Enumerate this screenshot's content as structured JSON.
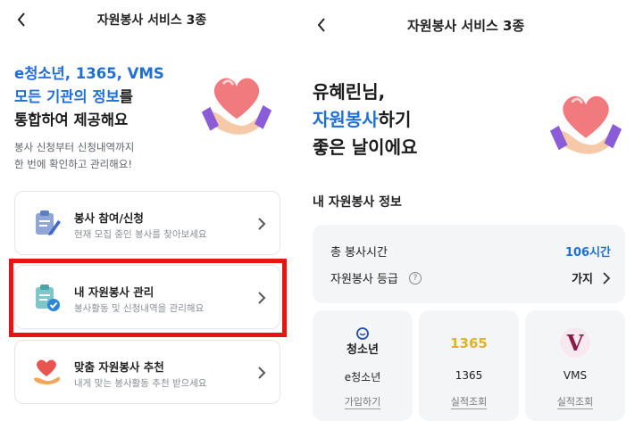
{
  "left": {
    "title": "자원봉사 서비스 3종",
    "hero": {
      "line1": "e청소년, 1365, VMS",
      "line2_blue": "모든 기관의 정보",
      "line2_rest": "를",
      "line3": "통합하여 제공해요"
    },
    "subtitle": {
      "line1": "봉사 신청부터 신청내역까지",
      "line2": "한 번에 확인하고 관리해요!"
    },
    "menu": [
      {
        "title": "봉사 참여/신청",
        "desc": "현재 모집 중인 봉사를 찾아보세요",
        "icon": "clipboard-pen-icon"
      },
      {
        "title": "내 자원봉사 관리",
        "desc": "봉사활동 및 신청내역을 관리해요",
        "icon": "clipboard-check-icon"
      },
      {
        "title": "맞춤 자원봉사 추천",
        "desc": "내게 맞는 봉사활동 추천 받으세요",
        "icon": "heart-hand-icon"
      }
    ]
  },
  "right": {
    "title": "자원봉사 서비스 3종",
    "hero": {
      "line1": "유혜린님,",
      "line2_blue": "자원봉사",
      "line2_rest": "하기",
      "line3": "좋은 날이에요"
    },
    "section_title": "내 자원봉사 정보",
    "info": {
      "hours_label": "총 봉사시간",
      "hours_value": "106시간",
      "grade_label": "자원봉사 등급",
      "grade_value": "가지"
    },
    "services": [
      {
        "logo_text": "청소년",
        "name": "e청소년",
        "link": "가입하기"
      },
      {
        "logo_text": "1365",
        "name": "1365",
        "link": "실적조회"
      },
      {
        "logo_text": "V",
        "name": "VMS",
        "link": "실적조회"
      }
    ]
  },
  "colors": {
    "accent": "#1f6fd6",
    "highlight": "#e81414",
    "card_bg": "#f3f5f7"
  }
}
